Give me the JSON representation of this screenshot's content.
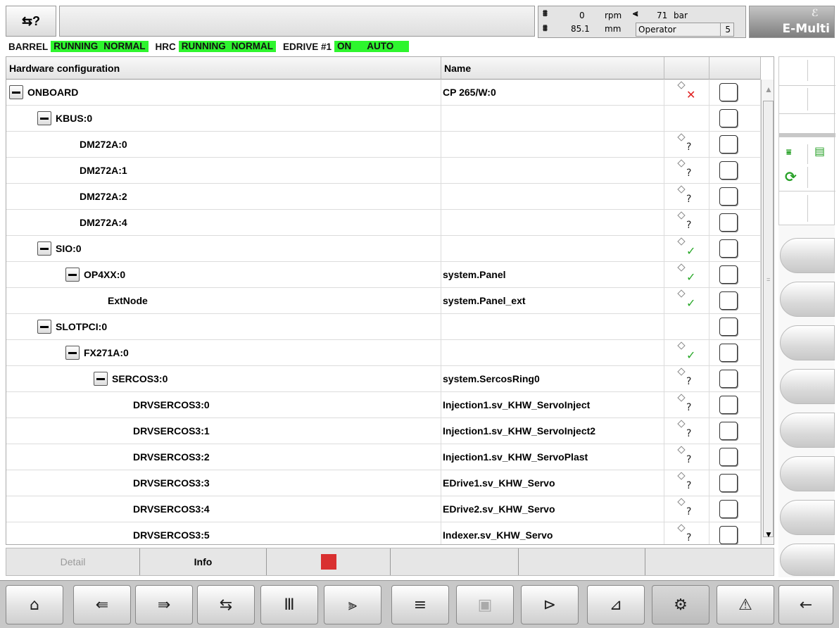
{
  "header": {
    "mode_icon": "manual-mode-icon",
    "message": "",
    "rpm_value": "0",
    "rpm_unit": "rpm",
    "stroke_value": "85.1",
    "stroke_unit": "mm",
    "pressure_value": "71",
    "pressure_unit": "bar",
    "user_level": "Operator",
    "user_level_number": "5",
    "logo": "E-Multi"
  },
  "status_bar": [
    {
      "label": "BARREL",
      "states": [
        "RUNNING",
        "NORMAL"
      ]
    },
    {
      "label": "HRC",
      "states": [
        "RUNNING",
        "NORMAL"
      ]
    },
    {
      "label": "EDRIVE #1",
      "states": [
        "ON",
        "AUTO"
      ]
    }
  ],
  "table": {
    "col_config": "Hardware configuration",
    "col_name": "Name",
    "col_status": "",
    "col_select": "",
    "rows": [
      {
        "label": "ONBOARD",
        "name": "CP 265/W:0",
        "indent": 0,
        "expander": true,
        "status": "error"
      },
      {
        "label": "KBUS:0",
        "name": "",
        "indent": 1,
        "expander": true,
        "status": "none"
      },
      {
        "label": "DM272A:0",
        "name": "",
        "indent": 2,
        "expander": false,
        "status": "unknown"
      },
      {
        "label": "DM272A:1",
        "name": "",
        "indent": 2,
        "expander": false,
        "status": "unknown"
      },
      {
        "label": "DM272A:2",
        "name": "",
        "indent": 2,
        "expander": false,
        "status": "unknown"
      },
      {
        "label": "DM272A:4",
        "name": "",
        "indent": 2,
        "expander": false,
        "status": "unknown"
      },
      {
        "label": "SIO:0",
        "name": "",
        "indent": 1,
        "expander": true,
        "status": "ok"
      },
      {
        "label": "OP4XX:0",
        "name": "system.Panel",
        "indent": 2,
        "expander": true,
        "status": "ok"
      },
      {
        "label": "ExtNode",
        "name": "system.Panel_ext",
        "indent": 3,
        "expander": false,
        "status": "ok"
      },
      {
        "label": "SLOTPCI:0",
        "name": "",
        "indent": 1,
        "expander": true,
        "status": "none"
      },
      {
        "label": "FX271A:0",
        "name": "",
        "indent": 2,
        "expander": true,
        "status": "ok"
      },
      {
        "label": "SERCOS3:0",
        "name": "system.SercosRing0",
        "indent": 3,
        "expander": true,
        "status": "unknown"
      },
      {
        "label": "DRVSERCOS3:0",
        "name": "Injection1.sv_KHW_ServoInject",
        "indent": 4,
        "expander": false,
        "status": "unknown"
      },
      {
        "label": "DRVSERCOS3:1",
        "name": "Injection1.sv_KHW_ServoInject2",
        "indent": 4,
        "expander": false,
        "status": "unknown"
      },
      {
        "label": "DRVSERCOS3:2",
        "name": "Injection1.sv_KHW_ServoPlast",
        "indent": 4,
        "expander": false,
        "status": "unknown"
      },
      {
        "label": "DRVSERCOS3:3",
        "name": "EDrive1.sv_KHW_Servo",
        "indent": 4,
        "expander": false,
        "status": "unknown"
      },
      {
        "label": "DRVSERCOS3:4",
        "name": "EDrive2.sv_KHW_Servo",
        "indent": 4,
        "expander": false,
        "status": "unknown"
      },
      {
        "label": "DRVSERCOS3:5",
        "name": "Indexer.sv_KHW_Servo",
        "indent": 4,
        "expander": false,
        "status": "unknown"
      }
    ]
  },
  "bottom_buttons": {
    "detail": "Detail",
    "info": "Info"
  },
  "status_glyphs": {
    "unknown": "?",
    "ok": "✓",
    "error": "✕"
  },
  "colors": {
    "status_green": "#2ef52e",
    "ok": "#28a828",
    "error": "#e02020",
    "stop": "#d93030"
  },
  "nav": [
    {
      "icon": "home-icon",
      "glyph": "⌂"
    },
    {
      "icon": "mold-icon",
      "glyph": "⇚"
    },
    {
      "icon": "injection-unit-icon",
      "glyph": "⇛"
    },
    {
      "icon": "ejector-icon",
      "glyph": "⇆"
    },
    {
      "icon": "temperature-icon",
      "glyph": "Ⅲ"
    },
    {
      "icon": "process-icon",
      "glyph": "⫸"
    },
    {
      "icon": "list-icon",
      "glyph": "≡"
    },
    {
      "icon": "robot-icon",
      "glyph": "▣"
    },
    {
      "icon": "door-icon",
      "glyph": "⊳"
    },
    {
      "icon": "graph-icon",
      "glyph": "⊿"
    },
    {
      "icon": "settings-icon",
      "glyph": "⚙"
    },
    {
      "icon": "alarm-icon",
      "glyph": "⚠"
    },
    {
      "icon": "back-icon",
      "glyph": "←"
    }
  ]
}
